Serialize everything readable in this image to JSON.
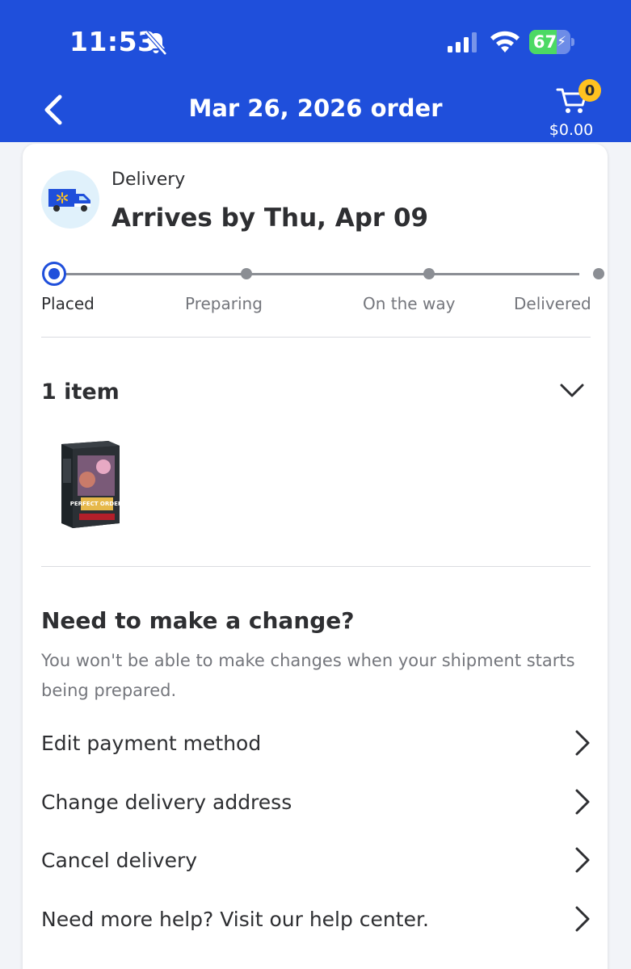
{
  "status_bar": {
    "time": "11:53",
    "battery": "67",
    "battery_level": 0.67,
    "icons": [
      "bell-slash-icon",
      "signal-icon",
      "wifi-icon",
      "battery-charging-icon"
    ]
  },
  "header": {
    "title": "Mar 26, 2026 order",
    "back_icon": "chevron-left-icon",
    "cart": {
      "count": "0",
      "total": "$0.00",
      "icon": "cart-icon"
    },
    "background_color": "#1f4fdb"
  },
  "delivery": {
    "type_label": "Delivery",
    "arrival": "Arrives by Thu, Apr 09",
    "icon": "delivery-truck-icon",
    "steps": [
      {
        "label": "Placed",
        "current": true
      },
      {
        "label": "Preparing",
        "current": false
      },
      {
        "label": "On the way",
        "current": false
      },
      {
        "label": "Delivered",
        "current": false
      }
    ]
  },
  "items": {
    "title": "1 item",
    "toggle_icon": "chevron-down-icon",
    "products": [
      {
        "image": "product-thumbnail",
        "box_text": "PERFECT ORDER"
      }
    ]
  },
  "changes": {
    "title": "Need to make a change?",
    "description": "You won't be able to make changes when your shipment starts being prepared.",
    "actions": [
      {
        "label": "Edit payment method"
      },
      {
        "label": "Change delivery address"
      },
      {
        "label": "Cancel delivery"
      },
      {
        "label": "Need more help? Visit our help center."
      }
    ]
  },
  "colors": {
    "accent": "#1f4fdb",
    "badge": "#ffc220",
    "battery_fill": "#4cd964",
    "muted_text": "#74767c"
  }
}
